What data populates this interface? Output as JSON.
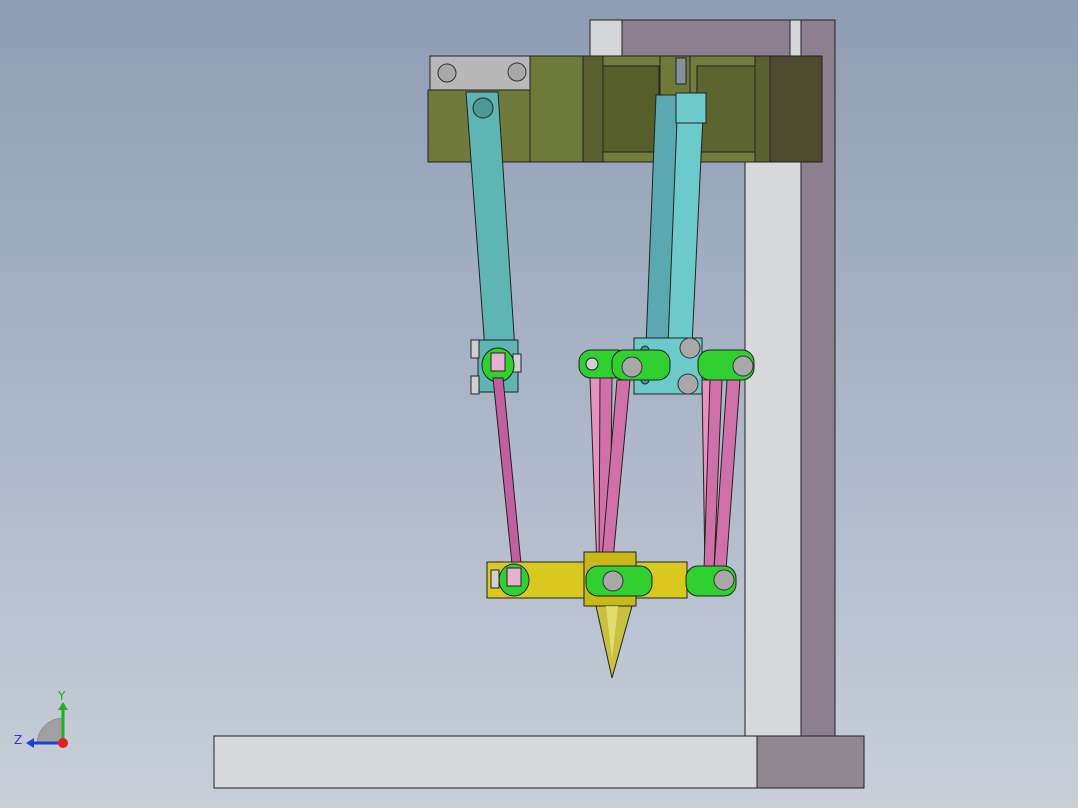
{
  "viewport": {
    "name": "cad-graphics-area",
    "background_top": "#8f9db4",
    "background_bottom": "#c8cfd9"
  },
  "colors": {
    "frame_light": "#d4d6d8",
    "frame_dark": "#8c8090",
    "block_olive": "#707a3c",
    "block_olive_dark": "#4e4a2e",
    "arm_cyan": "#5fb4b4",
    "rod_pink": "#d070a8",
    "joint_green": "#2fd02f",
    "platform_yellow": "#d8c820",
    "bolt_gray": "#b8b8b8"
  },
  "triad": {
    "x_axis_color": "#e02020",
    "y_axis_color": "#20b020",
    "z_axis_color": "#2040d0",
    "y_label": "Y",
    "z_label": "Z"
  }
}
